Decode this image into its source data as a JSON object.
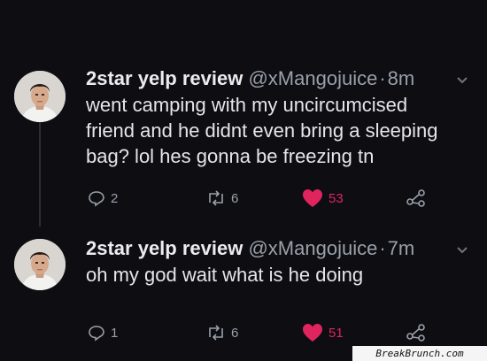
{
  "tweets": [
    {
      "name": "2star yelp review",
      "handle": "@xMangojuice",
      "separator": "·",
      "time": "8m",
      "text_lines": [
        "went camping with my uncircumcised",
        "friend and he didnt even bring a sleeping",
        "bag? lol hes gonna be freezing tn"
      ],
      "replies": "2",
      "retweets": "6",
      "likes": "53"
    },
    {
      "name": "2star yelp review",
      "handle": "@xMangojuice",
      "separator": "·",
      "time": "7m",
      "text_lines": [
        "oh my god wait what is he doing"
      ],
      "replies": "1",
      "retweets": "6",
      "likes": "51"
    }
  ],
  "icons": {
    "reply": "reply-icon",
    "retweet": "retweet-icon",
    "like": "heart-icon",
    "share": "share-icon",
    "menu": "chevron-down-icon"
  },
  "colors": {
    "background": "#0d0d12",
    "like": "#e0245e",
    "muted": "#9aa0aa"
  },
  "watermark": "BreakBrunch.com"
}
